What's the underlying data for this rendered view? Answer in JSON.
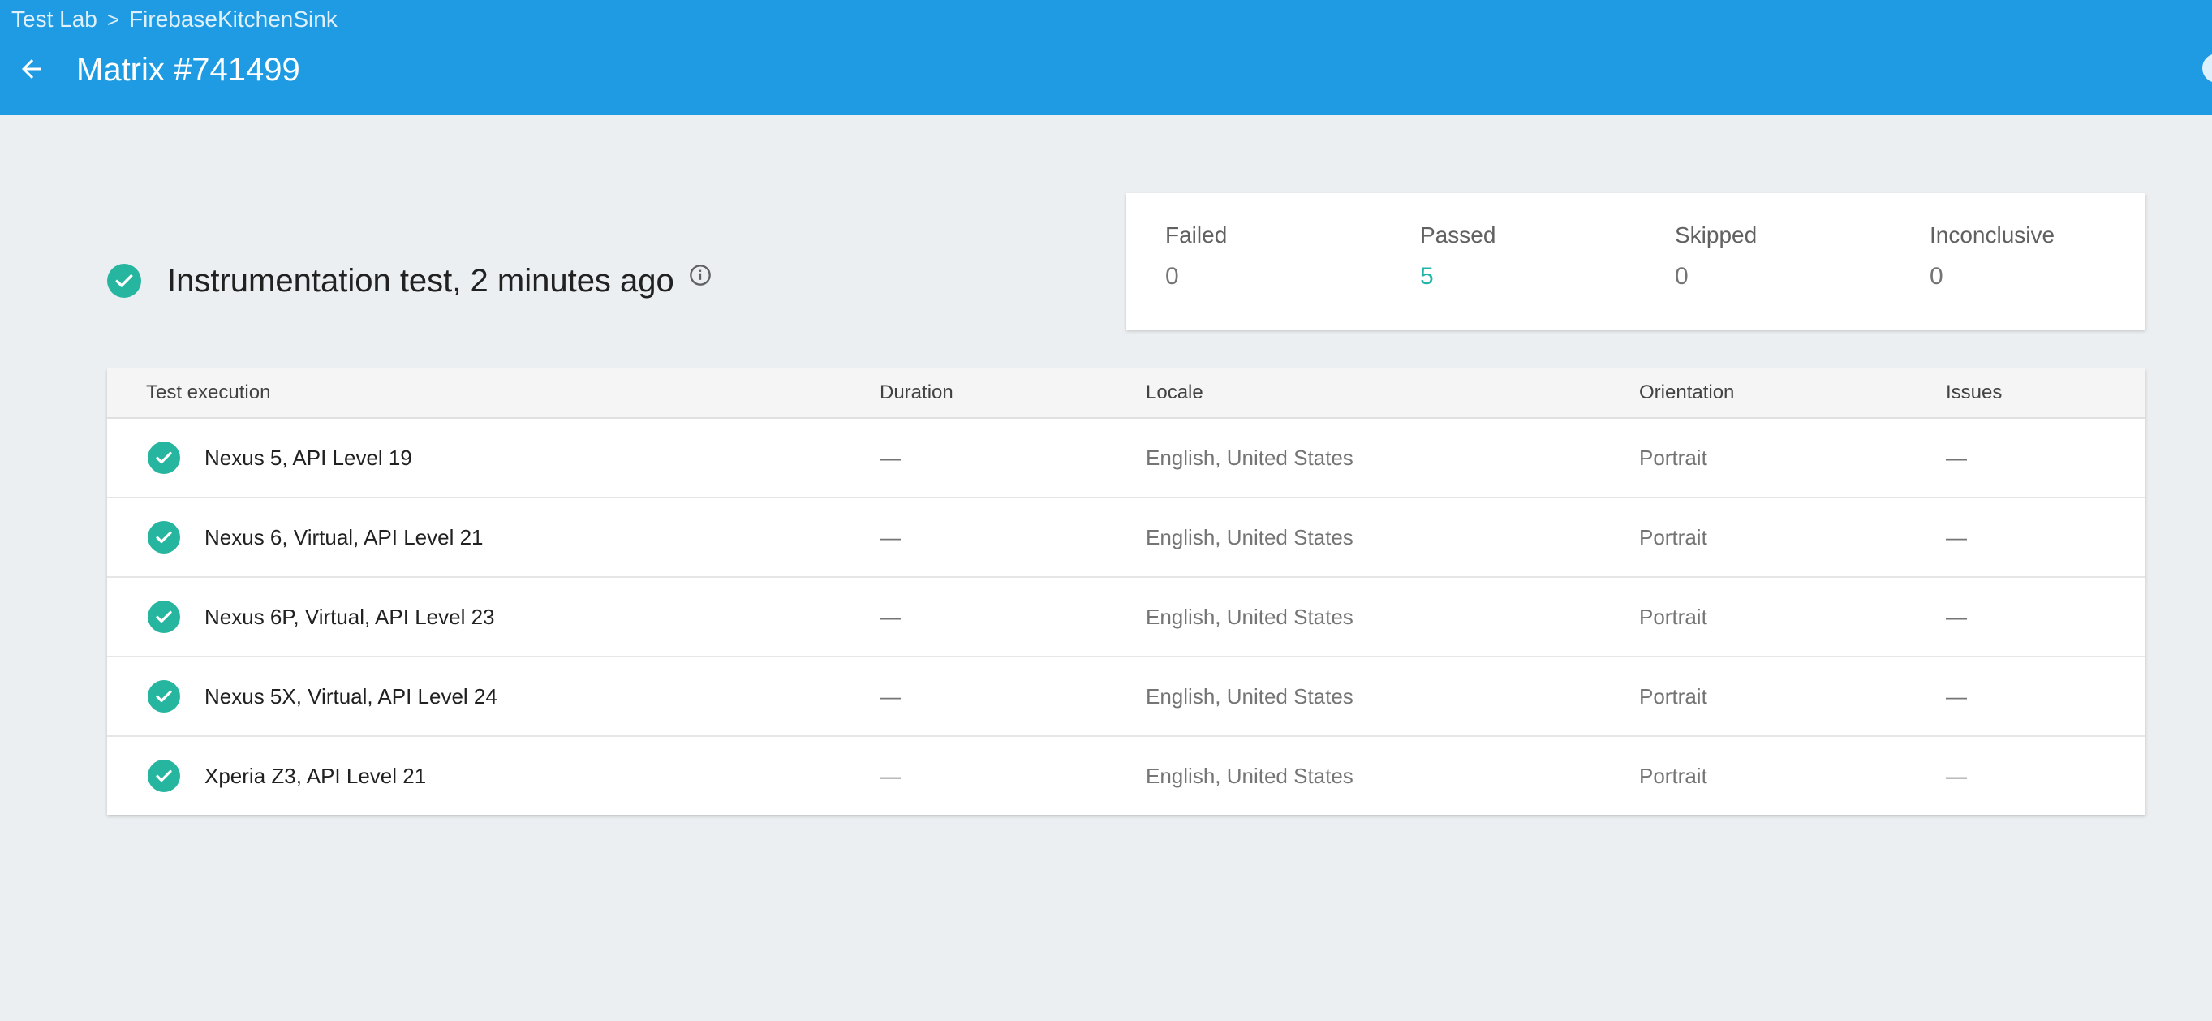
{
  "header": {
    "breadcrumb": [
      "Test Lab",
      "FirebaseKitchenSink"
    ],
    "breadcrumb_separator": ">",
    "title": "Matrix #741499",
    "back_icon": "arrow-left-icon",
    "background_color": "#1e9be3"
  },
  "summary": {
    "text": "Instrumentation test, 2 minutes ago",
    "status_icon": "check-circle-icon",
    "info_icon": "info-icon",
    "status_color": "#26b6a0"
  },
  "stats": [
    {
      "label": "Failed",
      "value": "0"
    },
    {
      "label": "Passed",
      "value": "5"
    },
    {
      "label": "Skipped",
      "value": "0"
    },
    {
      "label": "Inconclusive",
      "value": "0"
    }
  ],
  "table": {
    "columns": [
      "Test execution",
      "Duration",
      "Locale",
      "Orientation",
      "Issues"
    ],
    "rows": [
      {
        "device": "Nexus 5, API Level 19",
        "duration": "—",
        "locale": "English, United States",
        "orientation": "Portrait",
        "issues": "—"
      },
      {
        "device": "Nexus 6, Virtual, API Level 21",
        "duration": "—",
        "locale": "English, United States",
        "orientation": "Portrait",
        "issues": "—"
      },
      {
        "device": "Nexus 6P, Virtual, API Level 23",
        "duration": "—",
        "locale": "English, United States",
        "orientation": "Portrait",
        "issues": "—"
      },
      {
        "device": "Nexus 5X, Virtual, API Level 24",
        "duration": "—",
        "locale": "English, United States",
        "orientation": "Portrait",
        "issues": "—"
      },
      {
        "device": "Xperia Z3, API Level 21",
        "duration": "—",
        "locale": "English, United States",
        "orientation": "Portrait",
        "issues": "—"
      }
    ]
  }
}
